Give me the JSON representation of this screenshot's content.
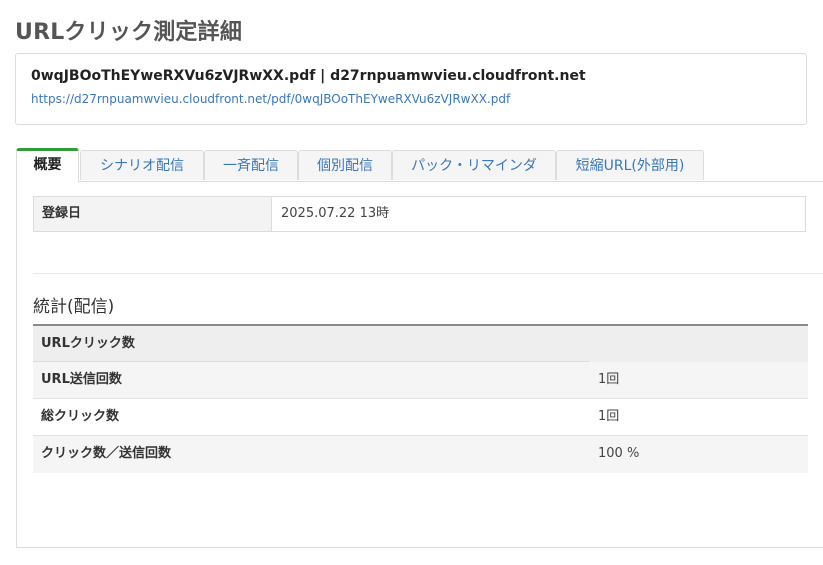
{
  "page": {
    "title": "URLクリック測定詳細"
  },
  "info": {
    "heading": "0wqJBOoThEYweRXVu6zVJRwXX.pdf | d27rnpuamwvieu.cloudfront.net",
    "url": "https://d27rnpuamwvieu.cloudfront.net/pdf/0wqJBOoThEYweRXVu6zVJRwXX.pdf"
  },
  "tabs": [
    {
      "label": "概要",
      "active": true
    },
    {
      "label": "シナリオ配信"
    },
    {
      "label": "一斉配信"
    },
    {
      "label": "個別配信"
    },
    {
      "label": "パック・リマインダ"
    },
    {
      "label": "短縮URL(外部用)"
    }
  ],
  "registration": {
    "label": "登録日",
    "value": "2025.07.22 13時"
  },
  "stats": {
    "title": "統計(配信)",
    "header": "URLクリック数",
    "rows": [
      {
        "label": "URL送信回数",
        "value": "1回"
      },
      {
        "label": "総クリック数",
        "value": "1回"
      },
      {
        "label": "クリック数／送信回数",
        "value": "100 %"
      }
    ]
  },
  "colors": {
    "accent": "#2e9d3a",
    "link": "#3a77b8"
  }
}
